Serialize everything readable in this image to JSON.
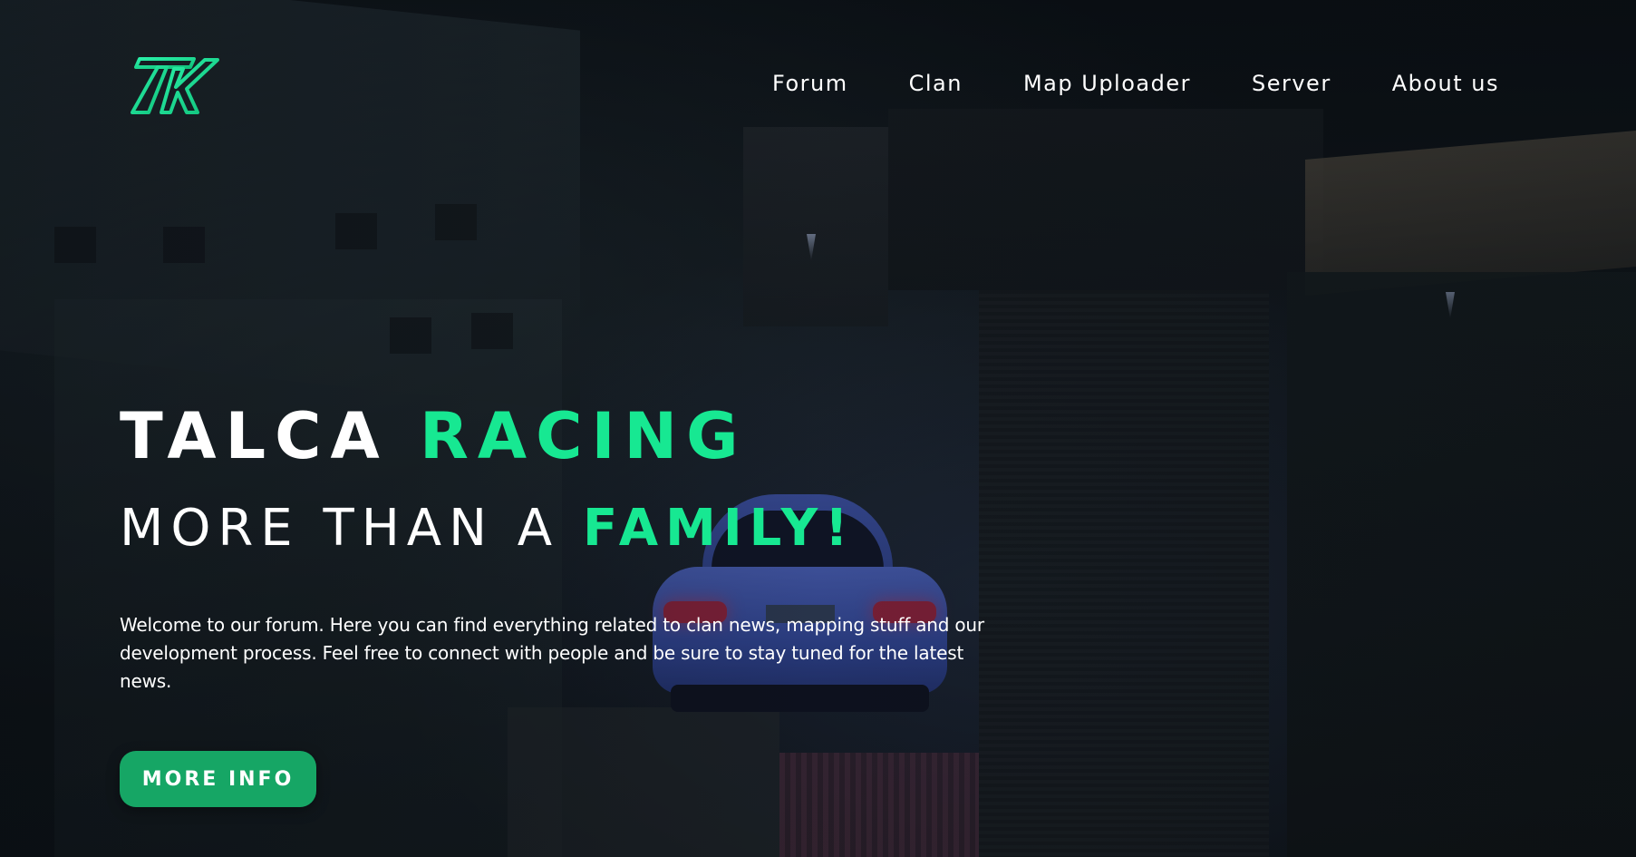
{
  "brand": {
    "logo_icon": "talca-racing-tr-logo",
    "accent_color": "#17e892",
    "button_color": "#16a665"
  },
  "nav": {
    "items": [
      {
        "label": "Forum"
      },
      {
        "label": "Clan"
      },
      {
        "label": "Map Uploader"
      },
      {
        "label": "Server"
      },
      {
        "label": "About us"
      }
    ]
  },
  "hero": {
    "title_white": "TALCA",
    "title_accent": "RACING",
    "subtitle_white": "MORE THAN A",
    "subtitle_accent": "FAMILY!",
    "description": "Welcome to our forum. Here you can find everything related to clan news, mapping stuff and our development process. Feel free to connect with people and be sure to stay tuned for the latest news.",
    "cta_label": "MORE INFO"
  }
}
